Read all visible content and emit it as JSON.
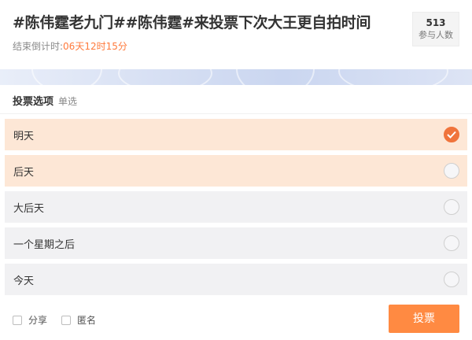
{
  "header": {
    "title": "#陈伟霆老九门##陈伟霆#来投票下次大王更自拍时间",
    "countdown_label": "结束倒计时:",
    "countdown_value": "06天12时15分",
    "participants_count": "513",
    "participants_label": "参与人数"
  },
  "options_section": {
    "label": "投票选项",
    "type": "单选",
    "options": [
      {
        "label": "明天",
        "checked": true
      },
      {
        "label": "后天",
        "checked": false
      },
      {
        "label": "大后天",
        "checked": false
      },
      {
        "label": "一个星期之后",
        "checked": false
      },
      {
        "label": "今天",
        "checked": false
      }
    ]
  },
  "footer": {
    "share_label": "分享",
    "anonymous_label": "匿名",
    "vote_button_label": "投票"
  },
  "colors": {
    "accent": "#ff8a42",
    "selected_bg": "#fde7d6",
    "countdown": "#ff7a3c"
  }
}
